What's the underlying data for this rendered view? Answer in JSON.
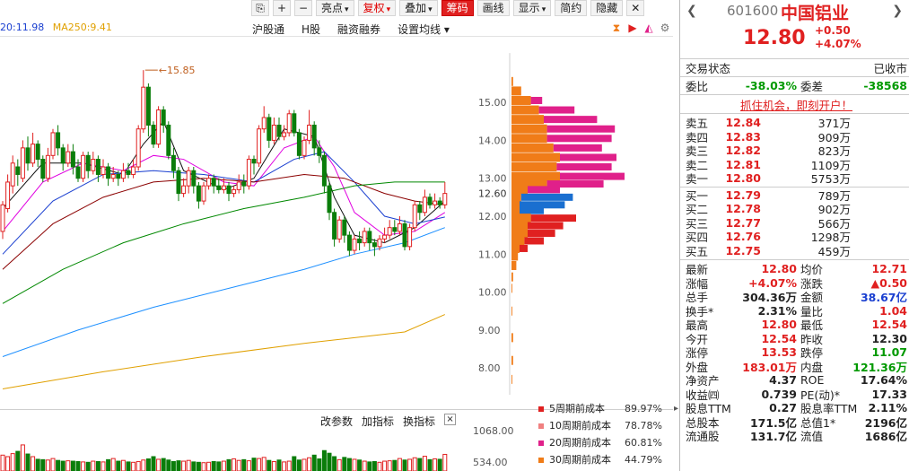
{
  "toolbar": {
    "buttons": [
      {
        "label": "亮点",
        "dropdown": true,
        "style": "normal"
      },
      {
        "label": "复权",
        "dropdown": true,
        "style": "red"
      },
      {
        "label": "叠加",
        "dropdown": true,
        "style": "normal"
      },
      {
        "label": "筹码",
        "dropdown": false,
        "style": "active"
      },
      {
        "label": "画线",
        "dropdown": false,
        "style": "normal"
      },
      {
        "label": "显示",
        "dropdown": true,
        "style": "normal"
      },
      {
        "label": "简约",
        "dropdown": false,
        "style": "normal"
      },
      {
        "label": "隐藏",
        "dropdown": false,
        "style": "normal"
      }
    ]
  },
  "ma_legend": [
    {
      "label": "20:11.98",
      "color": "#1a3fd0"
    },
    {
      "label": "MA250:9.41",
      "color": "#e0a000"
    }
  ],
  "market_links": [
    "沪股通",
    "H股",
    "融资融券",
    "设置均线 ▾"
  ],
  "chart_data": {
    "type": "candlestick",
    "price_axis_ticks": [
      15.0,
      14.0,
      13.0,
      12.0,
      11.0,
      10.0,
      9.0,
      8.0
    ],
    "last_price_label": "12.60",
    "high_annotation": "15.85",
    "ylim": [
      7.15,
      16.3
    ],
    "candles": [
      [
        11.6,
        12.3,
        11.4,
        12.4
      ],
      [
        12.2,
        12.9,
        12.1,
        13.1
      ],
      [
        12.8,
        13.4,
        12.6,
        13.6
      ],
      [
        13.3,
        13.1,
        12.8,
        13.5
      ],
      [
        13.0,
        13.8,
        12.9,
        14.0
      ],
      [
        13.8,
        13.4,
        13.2,
        14.1
      ],
      [
        13.4,
        13.9,
        13.3,
        14.2
      ],
      [
        13.9,
        13.5,
        13.3,
        14.0
      ],
      [
        13.5,
        13.0,
        12.9,
        13.6
      ],
      [
        13.0,
        13.6,
        12.9,
        13.8
      ],
      [
        13.6,
        14.2,
        13.5,
        14.3
      ],
      [
        14.2,
        13.8,
        13.6,
        14.4
      ],
      [
        13.8,
        13.4,
        13.2,
        13.9
      ],
      [
        13.4,
        13.7,
        13.3,
        13.9
      ],
      [
        13.7,
        13.3,
        13.1,
        13.9
      ],
      [
        13.3,
        13.0,
        12.9,
        13.5
      ],
      [
        13.0,
        13.6,
        12.9,
        13.7
      ],
      [
        13.6,
        13.2,
        13.0,
        13.7
      ],
      [
        13.2,
        13.5,
        13.1,
        13.7
      ],
      [
        13.5,
        13.1,
        12.9,
        13.6
      ],
      [
        13.1,
        13.3,
        13.0,
        13.5
      ],
      [
        13.3,
        13.0,
        12.8,
        13.4
      ],
      [
        13.0,
        13.1,
        12.9,
        13.3
      ],
      [
        13.1,
        13.0,
        12.8,
        13.2
      ],
      [
        13.0,
        13.2,
        12.9,
        13.4
      ],
      [
        13.2,
        13.1,
        13.0,
        13.4
      ],
      [
        13.1,
        13.3,
        13.0,
        13.5
      ],
      [
        13.3,
        14.3,
        13.2,
        14.4
      ],
      [
        14.3,
        15.4,
        14.2,
        15.85
      ],
      [
        15.4,
        14.4,
        14.1,
        15.5
      ],
      [
        14.4,
        13.9,
        13.8,
        14.5
      ],
      [
        13.9,
        14.8,
        13.8,
        14.9
      ],
      [
        14.8,
        14.4,
        14.2,
        14.9
      ],
      [
        14.4,
        13.6,
        13.5,
        14.5
      ],
      [
        13.6,
        13.2,
        13.0,
        13.8
      ],
      [
        13.2,
        12.6,
        12.4,
        13.3
      ],
      [
        12.6,
        12.8,
        12.5,
        13.0
      ],
      [
        12.8,
        13.2,
        12.6,
        13.3
      ],
      [
        13.2,
        12.8,
        12.6,
        13.3
      ],
      [
        12.8,
        12.4,
        12.2,
        12.9
      ],
      [
        12.4,
        12.8,
        12.3,
        12.9
      ],
      [
        12.8,
        13.0,
        12.7,
        13.1
      ],
      [
        13.0,
        12.8,
        12.6,
        13.1
      ],
      [
        12.8,
        12.7,
        12.6,
        13.0
      ],
      [
        12.7,
        12.8,
        12.6,
        13.0
      ],
      [
        12.8,
        12.6,
        12.4,
        12.9
      ],
      [
        12.6,
        12.7,
        12.5,
        12.8
      ],
      [
        12.7,
        12.9,
        12.6,
        13.1
      ],
      [
        12.9,
        12.8,
        12.6,
        13.1
      ],
      [
        12.8,
        13.5,
        12.7,
        13.6
      ],
      [
        13.5,
        13.4,
        13.1,
        13.6
      ],
      [
        13.4,
        14.3,
        13.3,
        14.4
      ],
      [
        14.3,
        14.6,
        14.2,
        14.9
      ],
      [
        14.6,
        14.0,
        13.8,
        14.7
      ],
      [
        14.0,
        14.4,
        13.9,
        14.6
      ],
      [
        14.4,
        14.1,
        14.0,
        14.6
      ],
      [
        14.1,
        14.2,
        14.0,
        14.4
      ],
      [
        14.2,
        14.7,
        14.1,
        14.8
      ],
      [
        14.7,
        14.2,
        14.1,
        14.8
      ],
      [
        14.2,
        13.6,
        13.5,
        14.3
      ],
      [
        13.6,
        14.0,
        13.5,
        14.1
      ],
      [
        14.0,
        14.4,
        13.9,
        14.8
      ],
      [
        14.4,
        13.8,
        13.6,
        14.5
      ],
      [
        13.8,
        13.6,
        13.4,
        14.0
      ],
      [
        13.6,
        12.8,
        12.6,
        13.7
      ],
      [
        12.8,
        12.1,
        11.9,
        12.9
      ],
      [
        12.1,
        11.4,
        11.2,
        12.2
      ],
      [
        11.4,
        11.9,
        11.3,
        12.0
      ],
      [
        11.9,
        11.5,
        11.3,
        12.0
      ],
      [
        11.5,
        11.1,
        10.95,
        11.6
      ],
      [
        11.1,
        11.4,
        11.0,
        11.5
      ],
      [
        11.4,
        11.3,
        11.1,
        11.6
      ],
      [
        11.3,
        11.6,
        11.2,
        11.7
      ],
      [
        11.6,
        11.3,
        11.1,
        11.7
      ],
      [
        11.3,
        11.2,
        10.95,
        11.4
      ],
      [
        11.2,
        11.4,
        11.1,
        11.5
      ],
      [
        11.4,
        11.5,
        11.3,
        11.7
      ],
      [
        11.5,
        11.7,
        11.4,
        11.9
      ],
      [
        11.7,
        11.6,
        11.5,
        11.9
      ],
      [
        11.6,
        11.8,
        11.5,
        12.0
      ],
      [
        11.8,
        11.2,
        11.1,
        11.9
      ],
      [
        11.2,
        11.7,
        11.1,
        11.8
      ],
      [
        11.7,
        12.3,
        11.6,
        12.4
      ],
      [
        12.3,
        12.1,
        11.9,
        12.4
      ],
      [
        12.1,
        12.5,
        12.0,
        12.7
      ],
      [
        12.5,
        12.3,
        12.2,
        12.6
      ],
      [
        12.3,
        12.4,
        12.2,
        12.6
      ],
      [
        12.4,
        12.3,
        12.2,
        12.5
      ],
      [
        12.3,
        12.6,
        12.2,
        12.9
      ]
    ],
    "moving_averages": [
      {
        "name": "MA5",
        "color": "#111111",
        "points": [
          [
            0,
            12.2
          ],
          [
            8,
            13.4
          ],
          [
            16,
            13.4
          ],
          [
            24,
            13.1
          ],
          [
            28,
            13.9
          ],
          [
            32,
            14.5
          ],
          [
            36,
            13.2
          ],
          [
            44,
            12.7
          ],
          [
            50,
            13.0
          ],
          [
            56,
            14.3
          ],
          [
            62,
            14.1
          ],
          [
            66,
            12.5
          ],
          [
            70,
            11.5
          ],
          [
            76,
            11.3
          ],
          [
            82,
            11.7
          ],
          [
            88,
            12.4
          ]
        ]
      },
      {
        "name": "MA10",
        "color": "#e000e0",
        "points": [
          [
            0,
            11.6
          ],
          [
            8,
            12.9
          ],
          [
            16,
            13.4
          ],
          [
            24,
            13.2
          ],
          [
            30,
            13.6
          ],
          [
            36,
            13.5
          ],
          [
            44,
            12.9
          ],
          [
            50,
            12.8
          ],
          [
            56,
            13.8
          ],
          [
            62,
            14.1
          ],
          [
            66,
            13.3
          ],
          [
            70,
            12.1
          ],
          [
            76,
            11.5
          ],
          [
            82,
            11.6
          ],
          [
            88,
            12.1
          ]
        ]
      },
      {
        "name": "MA20",
        "color": "#1a3fd0",
        "points": [
          [
            0,
            11.0
          ],
          [
            10,
            12.4
          ],
          [
            20,
            13.1
          ],
          [
            30,
            13.2
          ],
          [
            40,
            13.1
          ],
          [
            50,
            12.9
          ],
          [
            58,
            13.5
          ],
          [
            64,
            13.7
          ],
          [
            70,
            12.9
          ],
          [
            76,
            12.0
          ],
          [
            82,
            11.8
          ],
          [
            88,
            11.98
          ]
        ]
      },
      {
        "name": "MA30",
        "color": "#8b0000",
        "points": [
          [
            0,
            10.6
          ],
          [
            10,
            11.8
          ],
          [
            20,
            12.5
          ],
          [
            30,
            12.9
          ],
          [
            40,
            13.0
          ],
          [
            50,
            12.9
          ],
          [
            60,
            13.1
          ],
          [
            68,
            13.0
          ],
          [
            76,
            12.6
          ],
          [
            82,
            12.4
          ],
          [
            88,
            12.3
          ]
        ]
      },
      {
        "name": "MA60",
        "color": "#008800",
        "points": [
          [
            0,
            9.7
          ],
          [
            12,
            10.6
          ],
          [
            24,
            11.3
          ],
          [
            36,
            11.8
          ],
          [
            48,
            12.2
          ],
          [
            60,
            12.5
          ],
          [
            70,
            12.8
          ],
          [
            78,
            12.9
          ],
          [
            88,
            12.9
          ]
        ]
      },
      {
        "name": "MA120",
        "color": "#1e90ff",
        "points": [
          [
            0,
            8.3
          ],
          [
            15,
            9.0
          ],
          [
            30,
            9.6
          ],
          [
            45,
            10.1
          ],
          [
            60,
            10.6
          ],
          [
            70,
            11.0
          ],
          [
            80,
            11.3
          ],
          [
            88,
            11.7
          ]
        ]
      },
      {
        "name": "MA250",
        "color": "#e0a000",
        "points": [
          [
            0,
            7.45
          ],
          [
            20,
            7.9
          ],
          [
            40,
            8.3
          ],
          [
            60,
            8.65
          ],
          [
            80,
            8.95
          ],
          [
            88,
            9.41
          ]
        ]
      }
    ],
    "chip_profile": [
      {
        "price": 15.55,
        "orange": 0.01,
        "pink": 0.0
      },
      {
        "price": 15.3,
        "orange": 0.06,
        "pink": 0.0
      },
      {
        "price": 15.05,
        "orange": 0.12,
        "pink": 0.07
      },
      {
        "price": 14.8,
        "orange": 0.17,
        "pink": 0.22
      },
      {
        "price": 14.55,
        "orange": 0.2,
        "pink": 0.33
      },
      {
        "price": 14.3,
        "orange": 0.22,
        "pink": 0.42
      },
      {
        "price": 14.05,
        "orange": 0.22,
        "pink": 0.4
      },
      {
        "price": 13.8,
        "orange": 0.26,
        "pink": 0.3
      },
      {
        "price": 13.55,
        "orange": 0.3,
        "pink": 0.35
      },
      {
        "price": 13.3,
        "orange": 0.28,
        "pink": 0.34
      },
      {
        "price": 13.05,
        "orange": 0.3,
        "pink": 0.4
      },
      {
        "price": 12.85,
        "orange": 0.22,
        "pink": 0.35
      },
      {
        "price": 12.7,
        "orange": 0.1,
        "pink": 0.2
      },
      {
        "price": 12.5,
        "orange": 0.06,
        "blue": 0.32
      },
      {
        "price": 12.3,
        "orange": 0.05,
        "blue": 0.28
      },
      {
        "price": 12.15,
        "orange": 0.05,
        "blue": 0.15
      },
      {
        "price": 11.95,
        "orange": 0.12,
        "red": 0.28
      },
      {
        "price": 11.75,
        "orange": 0.1,
        "red": 0.22
      },
      {
        "price": 11.55,
        "orange": 0.1,
        "red": 0.17
      },
      {
        "price": 11.35,
        "orange": 0.08,
        "red": 0.12
      },
      {
        "price": 11.15,
        "orange": 0.05,
        "red": 0.05
      },
      {
        "price": 10.95,
        "orange": 0.04,
        "red": 0.0
      },
      {
        "price": 10.7,
        "orange": 0.03,
        "red": 0.0
      },
      {
        "price": 10.4,
        "orange": 0.01,
        "red": 0.0
      },
      {
        "price": 10.1,
        "orange": 0.005,
        "red": 0.0
      },
      {
        "price": 9.5,
        "orange": 0.005,
        "red": 0.0
      },
      {
        "price": 8.8,
        "orange": 0.01,
        "red": 0.0
      },
      {
        "price": 8.2,
        "orange": 0.01,
        "red": 0.0
      },
      {
        "price": 7.7,
        "orange": 0.005,
        "red": 0.0
      }
    ],
    "volume_axis_ticks": [
      "1068.00",
      "534.00"
    ],
    "volumes": [
      420,
      380,
      460,
      520,
      690,
      450,
      380,
      310,
      300,
      290,
      330,
      280,
      260,
      270,
      260,
      250,
      240,
      230,
      260,
      250,
      240,
      300,
      330,
      260,
      280,
      240,
      230,
      250,
      290,
      320,
      380,
      310,
      330,
      290,
      250,
      270,
      260,
      280,
      240,
      230,
      220,
      230,
      250,
      240,
      260,
      300,
      320,
      280,
      300,
      270,
      340,
      330,
      360,
      280,
      250,
      290,
      240,
      260,
      380,
      290,
      310,
      350,
      420,
      320,
      540,
      470,
      380,
      300,
      360,
      330,
      310,
      290,
      260,
      240,
      250,
      230,
      260,
      270,
      280,
      330,
      290,
      310,
      350,
      330,
      390,
      300,
      320,
      310,
      440
    ]
  },
  "chip_legend": [
    {
      "label": "5周期前成本",
      "value": "89.97%",
      "color": "#e02020"
    },
    {
      "label": "10周期前成本",
      "value": "78.78%",
      "color": "#f08080"
    },
    {
      "label": "20周期前成本",
      "value": "60.81%",
      "color": "#e0208a"
    },
    {
      "label": "30周期前成本",
      "value": "44.79%",
      "color": "#f07c18"
    }
  ],
  "volume_tools": [
    "改参数",
    "加指标",
    "换指标"
  ],
  "quote": {
    "code": "601600",
    "name": "中国铝业",
    "price": "12.80",
    "change": "+0.50",
    "change_pct": "+4.07%",
    "status_label": "交易状态",
    "status_value": "已收市",
    "ratio_label": "委比",
    "ratio_value": "-38.03%",
    "diff_label": "委差",
    "diff_value": "-38568",
    "promo": "抓住机会，即刻开户！",
    "asks": [
      {
        "label": "卖五",
        "price": "12.84",
        "vol": "371万"
      },
      {
        "label": "卖四",
        "price": "12.83",
        "vol": "909万"
      },
      {
        "label": "卖三",
        "price": "12.82",
        "vol": "823万"
      },
      {
        "label": "卖二",
        "price": "12.81",
        "vol": "1109万"
      },
      {
        "label": "卖一",
        "price": "12.80",
        "vol": "5753万"
      }
    ],
    "bids": [
      {
        "label": "买一",
        "price": "12.79",
        "vol": "789万"
      },
      {
        "label": "买二",
        "price": "12.78",
        "vol": "902万"
      },
      {
        "label": "买三",
        "price": "12.77",
        "vol": "566万"
      },
      {
        "label": "买四",
        "price": "12.76",
        "vol": "1298万"
      },
      {
        "label": "买五",
        "price": "12.75",
        "vol": "459万"
      }
    ],
    "stats": [
      {
        "k1": "最新",
        "v1": "12.80",
        "c1": "red",
        "k2": "均价",
        "v2": "12.71",
        "c2": "red"
      },
      {
        "k1": "涨幅",
        "v1": "+4.07%",
        "c1": "red",
        "k2": "涨跌",
        "v2": "▲0.50",
        "c2": "red"
      },
      {
        "k1": "总手",
        "v1": "304.36万",
        "c1": "",
        "k2": "金额",
        "v2": "38.67亿",
        "c2": "blue"
      },
      {
        "k1": "换手*",
        "v1": "2.31%",
        "c1": "",
        "k2": "量比",
        "v2": "1.04",
        "c2": "red"
      },
      {
        "k1": "最高",
        "v1": "12.80",
        "c1": "red",
        "k2": "最低",
        "v2": "12.54",
        "c2": "red"
      },
      {
        "k1": "今开",
        "v1": "12.54",
        "c1": "red",
        "k2": "昨收",
        "v2": "12.30",
        "c2": ""
      },
      {
        "k1": "涨停",
        "v1": "13.53",
        "c1": "red",
        "k2": "跌停",
        "v2": "11.07",
        "c2": "green"
      },
      {
        "k1": "外盘",
        "v1": "183.01万",
        "c1": "red",
        "k2": "内盘",
        "v2": "121.36万",
        "c2": "green"
      },
      {
        "k1": "净资产",
        "v1": "4.37",
        "c1": "",
        "k2": "ROE",
        "v2": "17.64%",
        "c2": ""
      },
      {
        "k1": "收益㈣",
        "v1": "0.739",
        "c1": "",
        "k2": "PE(动)*",
        "v2": "17.33",
        "c2": ""
      },
      {
        "k1": "股息TTM",
        "v1": "0.27",
        "c1": "",
        "k2": "股息率TTM",
        "v2": "2.11%",
        "c2": ""
      },
      {
        "k1": "总股本",
        "v1": "171.5亿",
        "c1": "",
        "k2": "总值1*",
        "v2": "2196亿",
        "c2": ""
      },
      {
        "k1": "流通股",
        "v1": "131.7亿",
        "c1": "",
        "k2": "流值",
        "v2": "1686亿",
        "c2": ""
      }
    ]
  }
}
